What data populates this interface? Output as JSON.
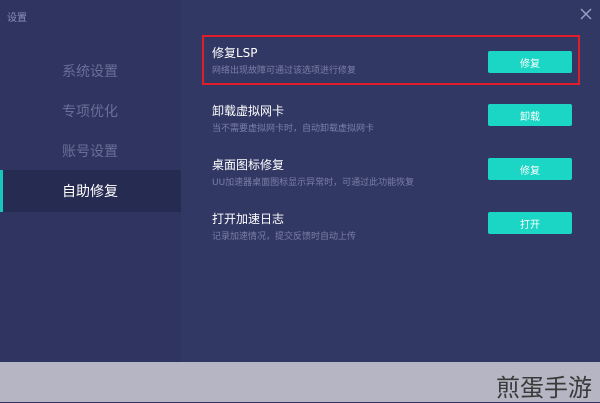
{
  "window": {
    "title": "设置"
  },
  "sidebar": {
    "items": [
      {
        "label": "系统设置",
        "active": false
      },
      {
        "label": "专项优化",
        "active": false
      },
      {
        "label": "账号设置",
        "active": false
      },
      {
        "label": "自助修复",
        "active": true
      }
    ]
  },
  "repair_items": [
    {
      "title": "修复LSP",
      "desc": "网络出现故障可通过该选项进行修复",
      "button": "修复"
    },
    {
      "title": "卸载虚拟网卡",
      "desc": "当不需要虚拟网卡时，自动卸载虚拟网卡",
      "button": "卸载"
    },
    {
      "title": "桌面图标修复",
      "desc": "UU加速器桌面图标显示异常时，可通过此功能恢复",
      "button": "修复"
    },
    {
      "title": "打开加速日志",
      "desc": "记录加速情况，提交反馈时自动上传",
      "button": "打开"
    }
  ],
  "watermark": "煎蛋手游",
  "colors": {
    "background": "#2f3560",
    "accent": "#1cd6c5",
    "highlight": "#e11d2a"
  },
  "icons": {
    "close": "close-icon"
  }
}
